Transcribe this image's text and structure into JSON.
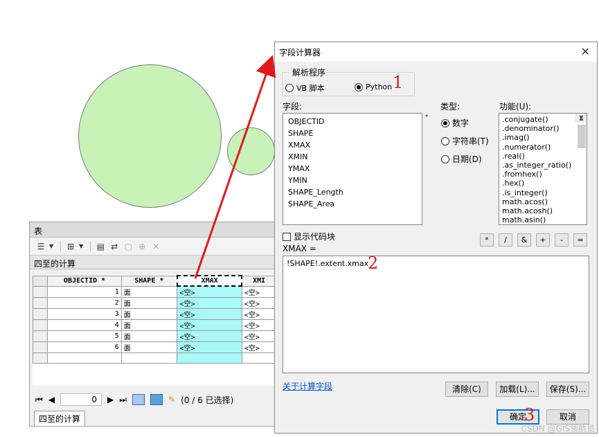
{
  "table_window": {
    "title": "表",
    "layer_name": "四至的计算",
    "columns": [
      "OBJECTID *",
      "SHAPE *",
      "XMAX",
      "XMI"
    ],
    "rows": [
      {
        "objectid": "1",
        "shape": "面",
        "xmax": "<空>",
        "xmin": "<空>"
      },
      {
        "objectid": "2",
        "shape": "面",
        "xmax": "<空>",
        "xmin": "<空>"
      },
      {
        "objectid": "3",
        "shape": "面",
        "xmax": "<空>",
        "xmin": "<空>"
      },
      {
        "objectid": "4",
        "shape": "面",
        "xmax": "<空>",
        "xmin": "<空>"
      },
      {
        "objectid": "5",
        "shape": "面",
        "xmax": "<空>",
        "xmin": "<空>"
      },
      {
        "objectid": "6",
        "shape": "面",
        "xmax": "<空>",
        "xmin": "<空>"
      }
    ],
    "nav": {
      "record": "0",
      "selection_status": "(0 / 6 已选择)"
    },
    "tab_label": "四至的计算"
  },
  "dialog": {
    "title": "字段计算器",
    "parser_label": "解析程序",
    "parser_options": {
      "vb": "VB 脚本",
      "python": "Python"
    },
    "parser_selected": "python",
    "fields_label": "字段:",
    "fields": [
      "OBJECTID",
      "SHAPE",
      "XMAX",
      "XMIN",
      "YMAX",
      "YMIN",
      "SHAPE_Length",
      "SHAPE_Area"
    ],
    "type_label": "类型:",
    "types": {
      "number": "数字",
      "string": "字符串(T)",
      "date": "日期(D)"
    },
    "type_selected": "number",
    "functions_label": "功能(U):",
    "functions": [
      ".conjugate()",
      ".denominator()",
      ".imag()",
      ".numerator()",
      ".real()",
      ".as_integer_ratio()",
      ".fromhex()",
      ".hex()",
      ".is_integer()",
      "math.acos()",
      "math.acosh()",
      "math.asin()"
    ],
    "show_codeblock_label": "显示代码块",
    "operators": [
      "*",
      "/",
      "&",
      "+",
      "-",
      "="
    ],
    "expression_label": "XMAX =",
    "expression": "!SHAPE!.extent.xmax",
    "about_link": "关于计算字段",
    "buttons": {
      "clear": "清除(C)",
      "load": "加载(L)...",
      "save": "保存(S)...",
      "ok": "确定",
      "cancel": "取消"
    }
  },
  "annotations": {
    "step1": "1",
    "step2": "2",
    "step3": "3",
    "arrow_color": "#e01b1b"
  },
  "watermark": "CSDN @GIS领航员"
}
